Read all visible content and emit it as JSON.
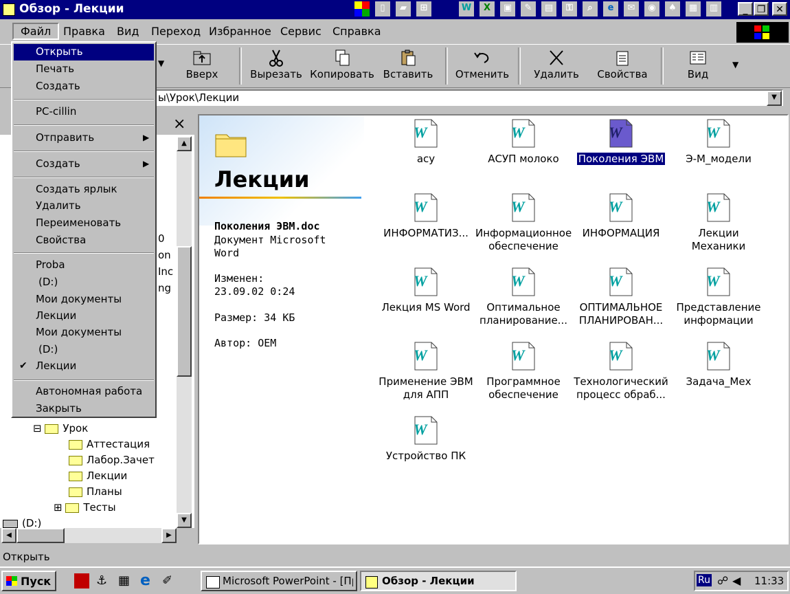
{
  "window": {
    "title": "Обзор - Лекции",
    "controls": [
      "_",
      "❐",
      "✕"
    ]
  },
  "menubar": [
    "Файл",
    "Правка",
    "Вид",
    "Переход",
    "Избранное",
    "Сервис",
    "Справка"
  ],
  "toolbar": [
    {
      "label": "Вверх",
      "icon": "folder-up-icon"
    },
    {
      "label": "Вырезать",
      "icon": "scissors-icon"
    },
    {
      "label": "Копировать",
      "icon": "copy-icon"
    },
    {
      "label": "Вставить",
      "icon": "paste-icon"
    },
    {
      "label": "Отменить",
      "icon": "undo-icon"
    },
    {
      "label": "Удалить",
      "icon": "delete-icon"
    },
    {
      "label": "Свойства",
      "icon": "properties-icon"
    },
    {
      "label": "Вид",
      "icon": "view-icon"
    }
  ],
  "address": {
    "visible_text": "ы\\Урок\\Лекции"
  },
  "file_menu": [
    {
      "label": "Открыть",
      "selected": true
    },
    {
      "label": "Печать"
    },
    {
      "label": "Создать"
    },
    {
      "label": "PC-cillin"
    },
    {
      "label": "Отправить",
      "submenu": true
    },
    {
      "label": "Создать",
      "submenu": true
    },
    {
      "label": "Создать ярлык"
    },
    {
      "label": "Удалить"
    },
    {
      "label": "Переименовать"
    },
    {
      "label": "Свойства"
    },
    {
      "label": "Proba"
    },
    {
      "label": "(D:)"
    },
    {
      "label": "Мои документы"
    },
    {
      "label": "Лекции"
    },
    {
      "label": "Мои документы"
    },
    {
      "label": "(D:)"
    },
    {
      "label": "Лекции",
      "checked": true
    },
    {
      "label": "Автономная работа"
    },
    {
      "label": "Закрыть"
    }
  ],
  "left_pane": {
    "close": "×",
    "partial_text": [
      "0",
      "on",
      "Inc",
      "ng"
    ],
    "tree": [
      {
        "label": "Урок",
        "expander": "⊟"
      },
      {
        "label": "Аттестация"
      },
      {
        "label": "Лабор.Зачет"
      },
      {
        "label": "Лекции"
      },
      {
        "label": "Планы"
      },
      {
        "label": "Тесты",
        "expander": "⊞"
      },
      {
        "label": "(D:)"
      }
    ]
  },
  "webview": {
    "folder_title": "Лекции",
    "filename": "Поколения ЭВМ.doc",
    "type": "Документ Microsoft Word",
    "modified_label": "Изменен:",
    "modified_value": "23.09.02 0:24",
    "size": "Размер: 34 КБ",
    "author": "Автор: OEM"
  },
  "files": [
    {
      "name": "асу"
    },
    {
      "name": "АСУП молоко"
    },
    {
      "name": "Поколения ЭВМ",
      "selected": true
    },
    {
      "name": "Э-М_модели"
    },
    {
      "name": "ИНФОРМАТИЗ..."
    },
    {
      "name": "Информационное обеспечение"
    },
    {
      "name": "ИНФОРМАЦИЯ"
    },
    {
      "name": "Лекции Механики"
    },
    {
      "name": "Лекция MS Word"
    },
    {
      "name": "Оптимальное планирование..."
    },
    {
      "name": "ОПТИМАЛЬНОЕ ПЛАНИРОВАН..."
    },
    {
      "name": "Представление информации"
    },
    {
      "name": "Применение ЭВМ для АПП"
    },
    {
      "name": "Программное обеспечение"
    },
    {
      "name": "Технологический процесс обраб..."
    },
    {
      "name": "Задача_Мех"
    },
    {
      "name": "Устройство ПК"
    }
  ],
  "status": "Открыть",
  "taskbar": {
    "start": "Пуск",
    "tasks": [
      {
        "label": "Microsoft PowerPoint - [Пр..."
      },
      {
        "label": "Обзор - Лекции",
        "active": true
      }
    ],
    "lang": "Ru",
    "clock": "11:33"
  },
  "colors": {
    "titlebar": "#000080",
    "face": "#c0c0c0",
    "selection": "#000080",
    "word_icon": "#00a0a0"
  }
}
